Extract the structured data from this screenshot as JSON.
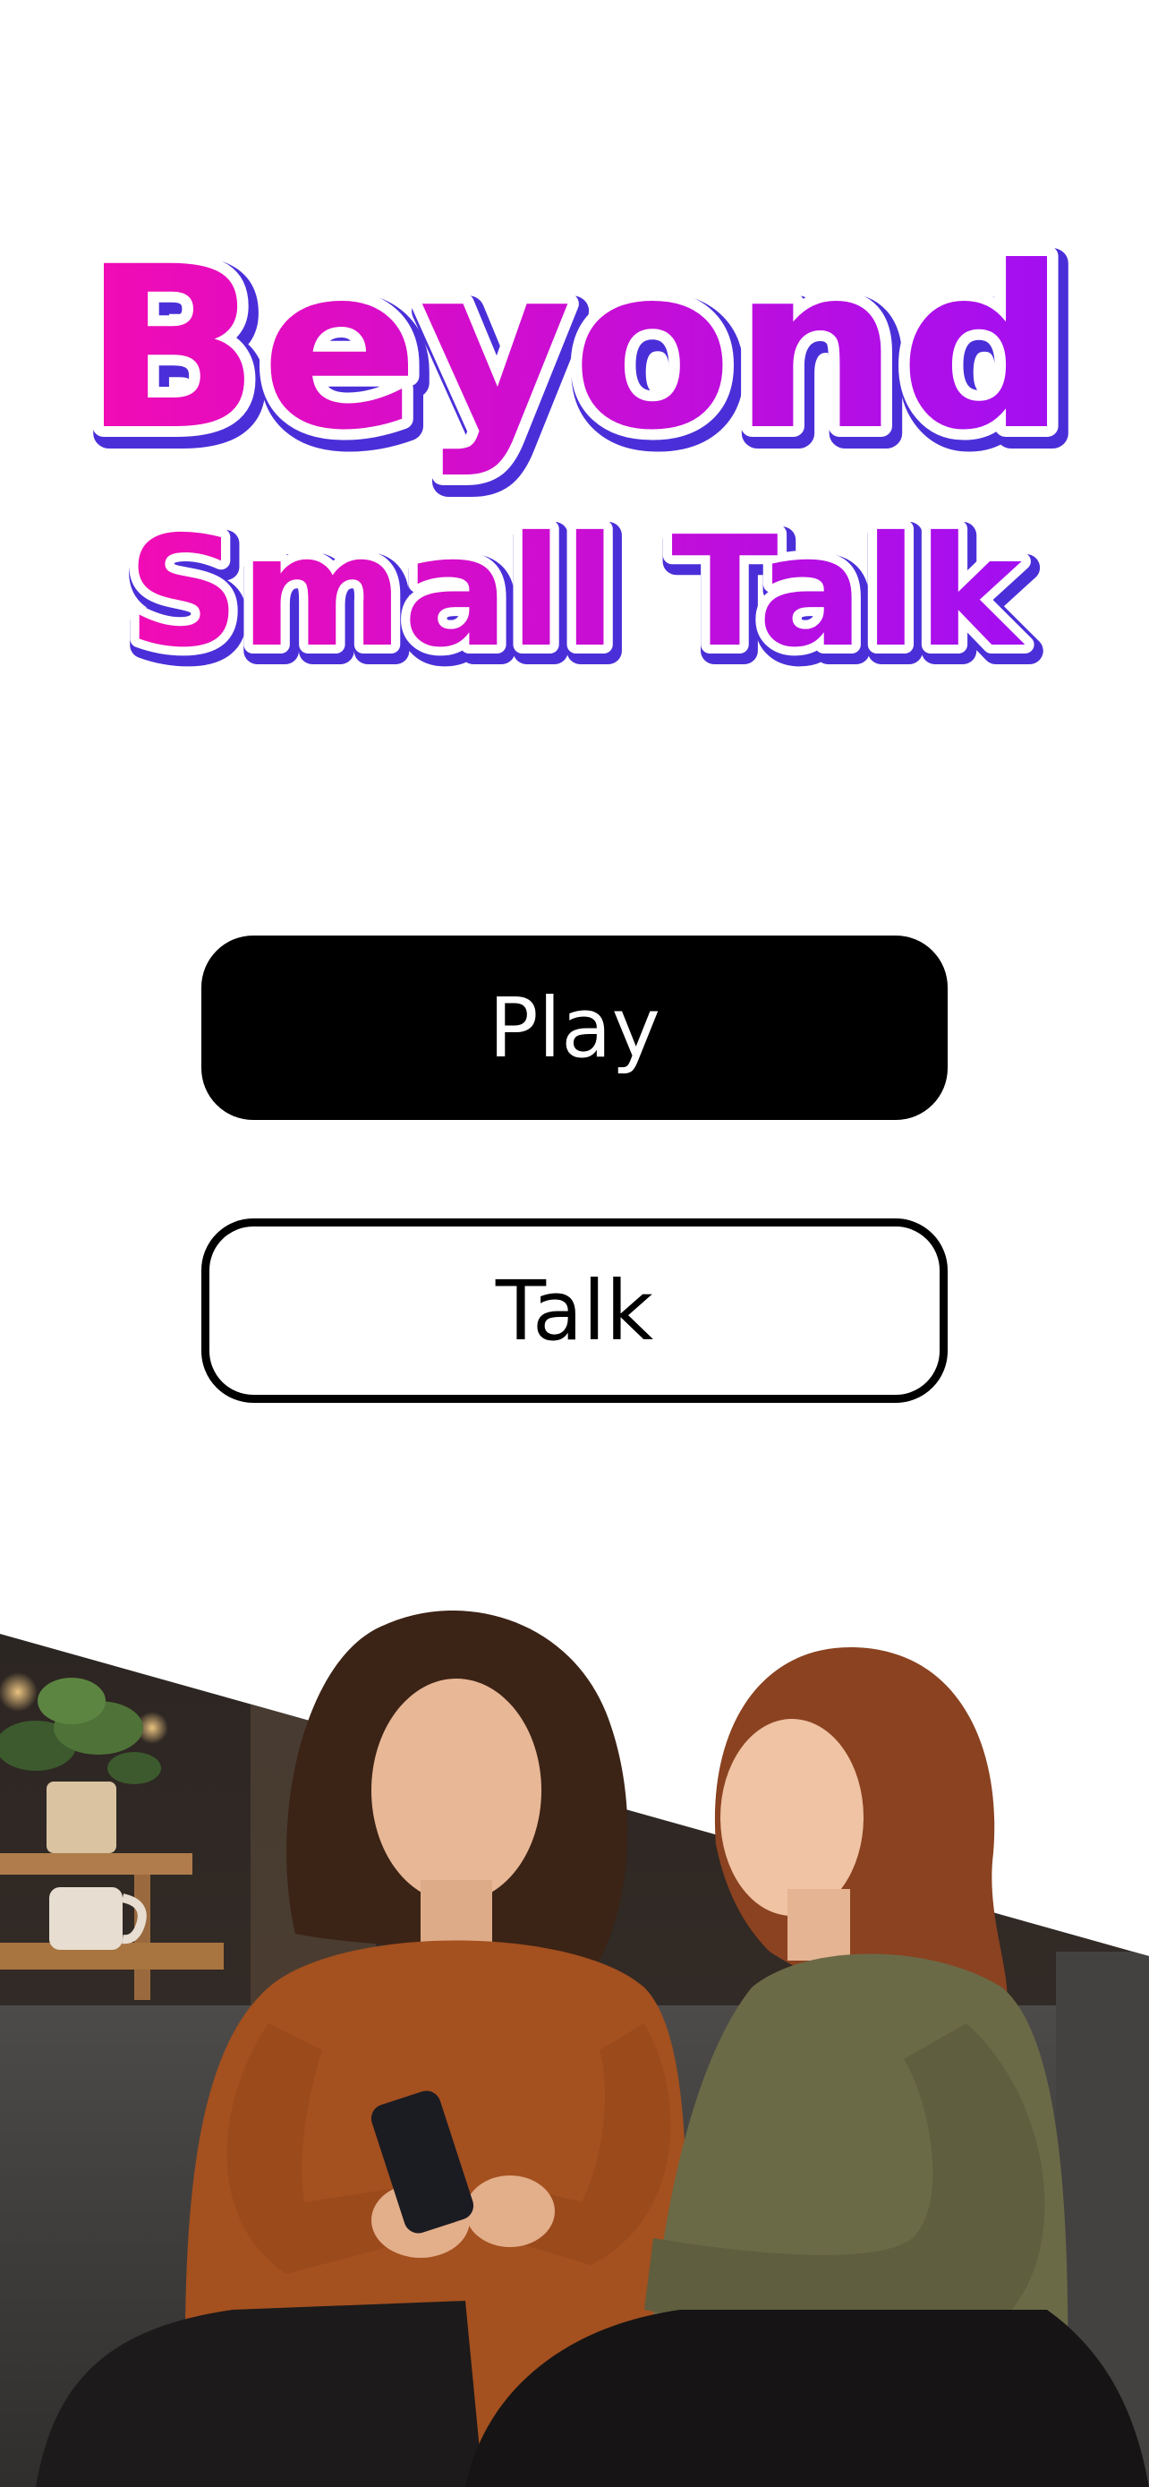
{
  "app": {
    "title_line_1": "Beyond",
    "title_line_2": "Small Talk"
  },
  "actions": {
    "play_label": "Play",
    "talk_label": "Talk"
  },
  "colors": {
    "title_gradient_start": "#f20cb4",
    "title_gradient_end": "#a20ff2",
    "title_outline": "#4a2fd8",
    "primary_button_bg": "#000000",
    "primary_button_text": "#ffffff",
    "secondary_button_border": "#000000",
    "background": "#ffffff"
  },
  "hero": {
    "image_subject": "two-women-on-sofa-looking-at-phone"
  }
}
